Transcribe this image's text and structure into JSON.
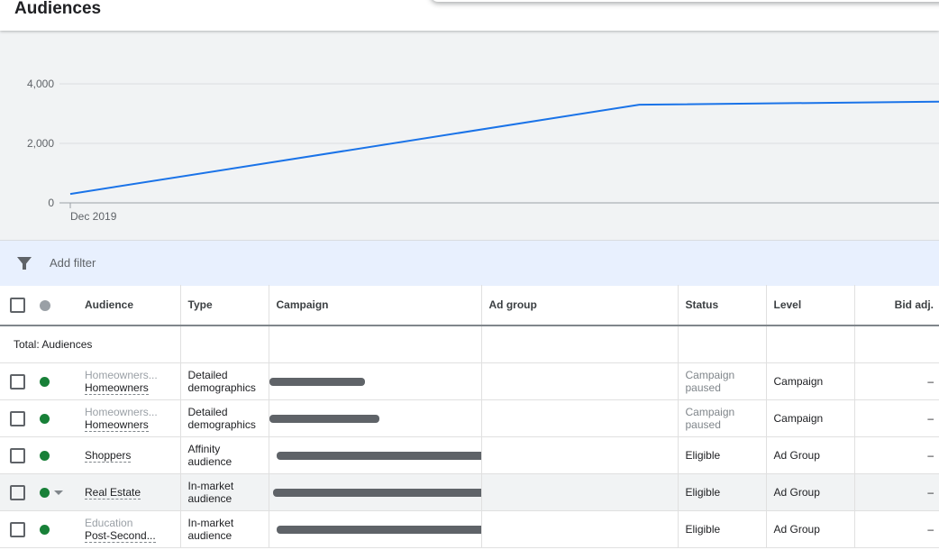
{
  "page": {
    "title": "Audiences"
  },
  "chart_data": {
    "type": "line",
    "x_start_label": "Dec 2019",
    "y_ticks": [
      "0",
      "2,000",
      "4,000"
    ],
    "ylim": [
      0,
      4000
    ],
    "series": [
      {
        "x": [
          0,
          0.655,
          1.0
        ],
        "values": [
          300,
          3300,
          3400
        ]
      }
    ],
    "colors": {
      "line": "#1a73e8",
      "grid": "#dadce0",
      "axis": "#9aa0a6"
    }
  },
  "filter": {
    "label": "Add filter"
  },
  "table": {
    "columns": {
      "audience": "Audience",
      "type": "Type",
      "campaign": "Campaign",
      "ad_group": "Ad group",
      "status": "Status",
      "level": "Level",
      "bid_adj": "Bid adj."
    },
    "total_label": "Total: Audiences",
    "rows": [
      {
        "audience_sub": "Homeowners...",
        "audience": "Homeowners",
        "type_line1": "Detailed",
        "type_line2": "demographics",
        "status_line1": "Campaign",
        "status_line2": "paused",
        "status_muted": true,
        "level": "Campaign",
        "bid_adj": "–"
      },
      {
        "audience_sub": "Homeowners...",
        "audience": "Homeowners",
        "type_line1": "Detailed",
        "type_line2": "demographics",
        "status_line1": "Campaign",
        "status_line2": "paused",
        "status_muted": true,
        "level": "Campaign",
        "bid_adj": "–"
      },
      {
        "audience_sub": "",
        "audience": "Shoppers",
        "type_line1": "Affinity",
        "type_line2": "audience",
        "status_line1": "Eligible",
        "status_line2": "",
        "status_muted": false,
        "level": "Ad Group",
        "bid_adj": "–"
      },
      {
        "audience_sub": "",
        "audience": "Real Estate",
        "type_line1": "In-market",
        "type_line2": "audience",
        "status_line1": "Eligible",
        "status_line2": "",
        "status_muted": false,
        "level": "Ad Group",
        "bid_adj": "–"
      },
      {
        "audience_sub": "Education",
        "audience": "Post-Second...",
        "type_line1": "In-market",
        "type_line2": "audience",
        "status_line1": "Eligible",
        "status_line2": "",
        "status_muted": false,
        "level": "Ad Group",
        "bid_adj": "–"
      }
    ]
  },
  "colors": {
    "enabled_dot": "#188038",
    "filter_bg": "#e8f0fe"
  },
  "icons": {
    "filter": "filter-icon",
    "row_caret": "chevron-down-icon"
  }
}
